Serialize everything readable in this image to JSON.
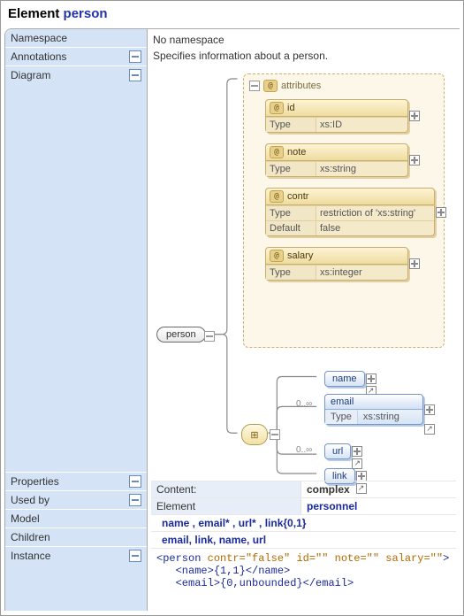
{
  "title": {
    "label": "Element",
    "name": "person"
  },
  "sidebar": {
    "namespace": "Namespace",
    "annotations": "Annotations",
    "diagram": "Diagram",
    "properties": "Properties",
    "usedby": "Used by",
    "model": "Model",
    "children": "Children",
    "instance": "Instance"
  },
  "namespace_value": "No namespace",
  "annotation_value": "Specifies information about a person.",
  "diagram": {
    "root_label": "person",
    "attr_header": "attributes",
    "attrs": [
      {
        "name": "id",
        "rows": [
          [
            "Type",
            "xs:ID"
          ]
        ]
      },
      {
        "name": "note",
        "rows": [
          [
            "Type",
            "xs:string"
          ]
        ]
      },
      {
        "name": "contr",
        "rows": [
          [
            "Type",
            "restriction of 'xs:string'"
          ],
          [
            "Default",
            "false"
          ]
        ],
        "wide": true
      },
      {
        "name": "salary",
        "rows": [
          [
            "Type",
            "xs:integer"
          ]
        ]
      }
    ],
    "elements": {
      "name": {
        "label": "name"
      },
      "email": {
        "label": "email",
        "type_row": [
          "Type",
          "xs:string"
        ],
        "mult": "0..∞"
      },
      "url": {
        "label": "url",
        "mult": "0..∞"
      },
      "link": {
        "label": "link"
      }
    }
  },
  "properties": {
    "label": "Content:",
    "value": "complex"
  },
  "usedby": {
    "label": "Element",
    "value": "personnel"
  },
  "model_value": "name , email* , url* , link{0,1}",
  "children_value": "email, link, name, url",
  "instance_lines": [
    {
      "open": "<person",
      "attrs": " contr=\"false\" id=\"\" note=\"\" salary=\"\"",
      "close": ">"
    },
    {
      "indent": "   ",
      "inner": "<name>{1,1}</name>"
    },
    {
      "indent": "   ",
      "inner": "<email>{0,unbounded}</email>"
    }
  ]
}
